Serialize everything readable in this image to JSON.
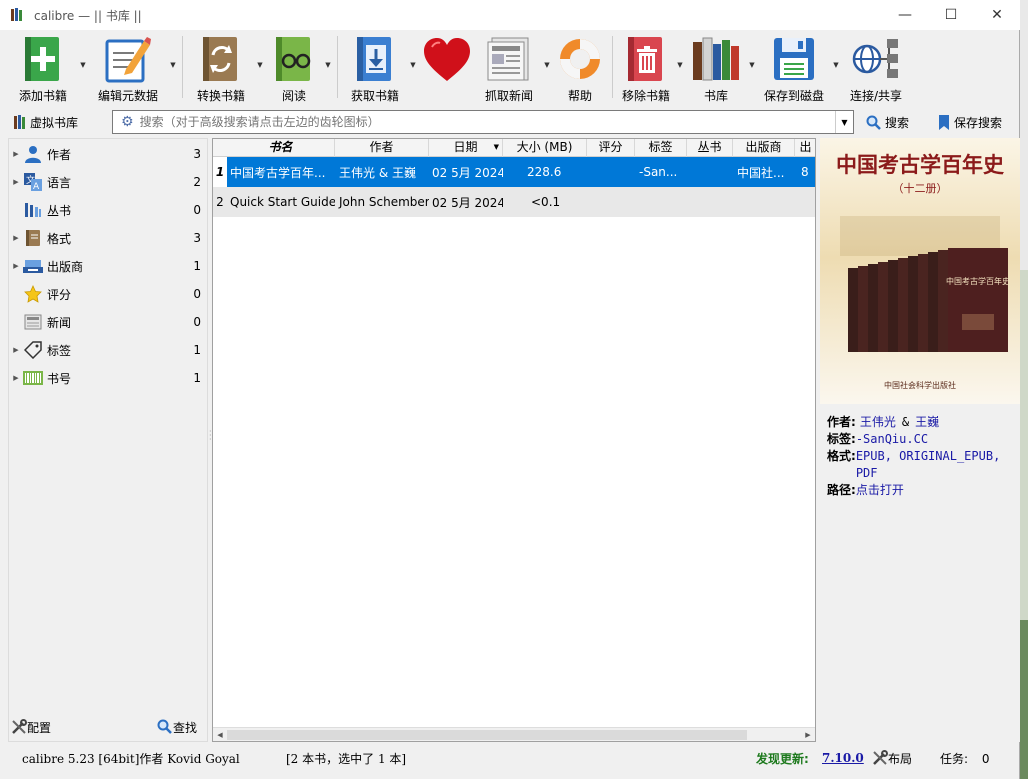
{
  "window": {
    "title": "calibre — || 书库 ||",
    "minimize": "—",
    "maximize": "☐",
    "close": "✕"
  },
  "toolbar": [
    {
      "label": "添加书籍",
      "icon": "add-book-icon"
    },
    {
      "label": "编辑元数据",
      "icon": "edit-metadata-icon"
    },
    {
      "label": "转换书籍",
      "icon": "convert-book-icon"
    },
    {
      "label": "阅读",
      "icon": "read-book-icon"
    },
    {
      "label": "获取书籍",
      "icon": "get-books-icon"
    },
    {
      "label": "",
      "icon": "heart-icon"
    },
    {
      "label": "抓取新闻",
      "icon": "news-icon"
    },
    {
      "label": "帮助",
      "icon": "help-lifebuoy-icon"
    },
    {
      "label": "移除书籍",
      "icon": "remove-book-icon"
    },
    {
      "label": "书库",
      "icon": "library-icon"
    },
    {
      "label": "保存到磁盘",
      "icon": "save-disk-icon"
    },
    {
      "label": "连接/共享",
      "icon": "connect-share-icon"
    }
  ],
  "searchbar": {
    "virtual_library": "虚拟书库",
    "placeholder": "搜索（对于高级搜索请点击左边的齿轮图标）",
    "search_label": "搜索",
    "save_search_label": "保存搜索"
  },
  "tag_browser": {
    "items": [
      {
        "label": "作者",
        "count": "3",
        "expandable": true,
        "icon": "author-icon"
      },
      {
        "label": "语言",
        "count": "2",
        "expandable": true,
        "icon": "language-icon"
      },
      {
        "label": "丛书",
        "count": "0",
        "expandable": false,
        "icon": "series-icon"
      },
      {
        "label": "格式",
        "count": "3",
        "expandable": true,
        "icon": "format-icon"
      },
      {
        "label": "出版商",
        "count": "1",
        "expandable": true,
        "icon": "publisher-icon"
      },
      {
        "label": "评分",
        "count": "0",
        "expandable": false,
        "icon": "rating-star-icon"
      },
      {
        "label": "新闻",
        "count": "0",
        "expandable": false,
        "icon": "news-small-icon"
      },
      {
        "label": "标签",
        "count": "1",
        "expandable": true,
        "icon": "tag-icon"
      },
      {
        "label": "书号",
        "count": "1",
        "expandable": true,
        "icon": "barcode-icon"
      }
    ],
    "configure_label": "配置",
    "find_label": "查找"
  },
  "book_list": {
    "columns": [
      "书名",
      "作者",
      "日期",
      "大小 (MB)",
      "评分",
      "标签",
      "丛书",
      "出版商",
      "出"
    ],
    "rows": [
      {
        "num": "1",
        "title": "中国考古学百年...",
        "author": "王伟光 & 王巍",
        "date": "02 5月 2024",
        "size": "228.6",
        "rating": "",
        "tags": "-San...",
        "series": "",
        "publisher": "中国社...",
        "extra": "8",
        "selected": true
      },
      {
        "num": "2",
        "title": "Quick Start Guide",
        "author": "John Schember",
        "date": "02 5月 2024",
        "size": "<0.1",
        "rating": "",
        "tags": "",
        "series": "",
        "publisher": "",
        "extra": "",
        "selected": false
      }
    ]
  },
  "details": {
    "cover_title": "中国考古学百年史",
    "cover_subtitle": "（十二册）",
    "cover_book_spine_title": "中国考古学百年史",
    "cover_publisher": "中国社会科学出版社",
    "author_key": "作者:",
    "author_1": "王伟光",
    "author_sep": "&",
    "author_2": "王巍",
    "tags_key": "标签:",
    "tags_val": "-SanQiu.CC",
    "formats_key": "格式:",
    "formats_val": "EPUB, ORIGINAL_EPUB, PDF",
    "path_key": "路径:",
    "path_val": "点击打开"
  },
  "statusbar": {
    "version": "calibre 5.23 [64bit]作者 Kovid Goyal",
    "selection": "[2 本书，选中了 1 本]",
    "update_label": "发现更新:",
    "update_version": "7.10.0",
    "layout_label": "布局",
    "jobs_label": "任务:",
    "jobs_count": "0"
  },
  "colors": {
    "selection": "#0078d7",
    "link": "#1a1aa6",
    "update": "#1e7a1e",
    "cover_bg": "#fbf5e6",
    "cover_title": "#8b1a1a"
  }
}
